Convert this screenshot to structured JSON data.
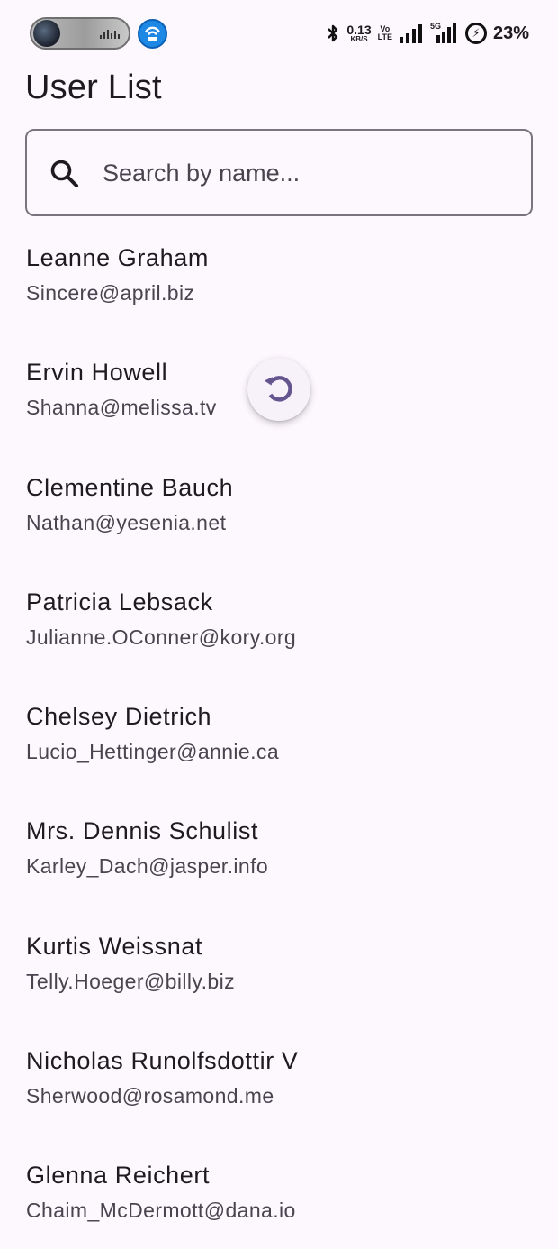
{
  "status_bar": {
    "speed_value": "0.13",
    "speed_unit": "KB/S",
    "volte_top": "Vo",
    "volte_bottom": "LTE",
    "network_label": "5G",
    "battery_percent": "23%"
  },
  "app": {
    "title": "User List"
  },
  "search": {
    "placeholder": "Search by name...",
    "value": ""
  },
  "users": [
    {
      "name": "Leanne Graham",
      "email": "Sincere@april.biz"
    },
    {
      "name": "Ervin Howell",
      "email": "Shanna@melissa.tv"
    },
    {
      "name": "Clementine Bauch",
      "email": "Nathan@yesenia.net"
    },
    {
      "name": "Patricia Lebsack",
      "email": "Julianne.OConner@kory.org"
    },
    {
      "name": "Chelsey Dietrich",
      "email": "Lucio_Hettinger@annie.ca"
    },
    {
      "name": "Mrs. Dennis Schulist",
      "email": "Karley_Dach@jasper.info"
    },
    {
      "name": "Kurtis Weissnat",
      "email": "Telly.Hoeger@billy.biz"
    },
    {
      "name": "Nicholas Runolfsdottir V",
      "email": "Sherwood@rosamond.me"
    },
    {
      "name": "Glenna Reichert",
      "email": "Chaim_McDermott@dana.io"
    }
  ],
  "colors": {
    "background": "#fdf7fe",
    "accent": "#65558f",
    "text_primary": "#1d1b20",
    "text_secondary": "#49454f",
    "outline": "#79747e"
  },
  "icons": {
    "search": "search-icon",
    "refresh": "refresh-icon",
    "bluetooth": "bluetooth-icon",
    "signal": "signal-icon",
    "battery": "battery-charging-icon",
    "hotspot": "hotspot-icon"
  }
}
